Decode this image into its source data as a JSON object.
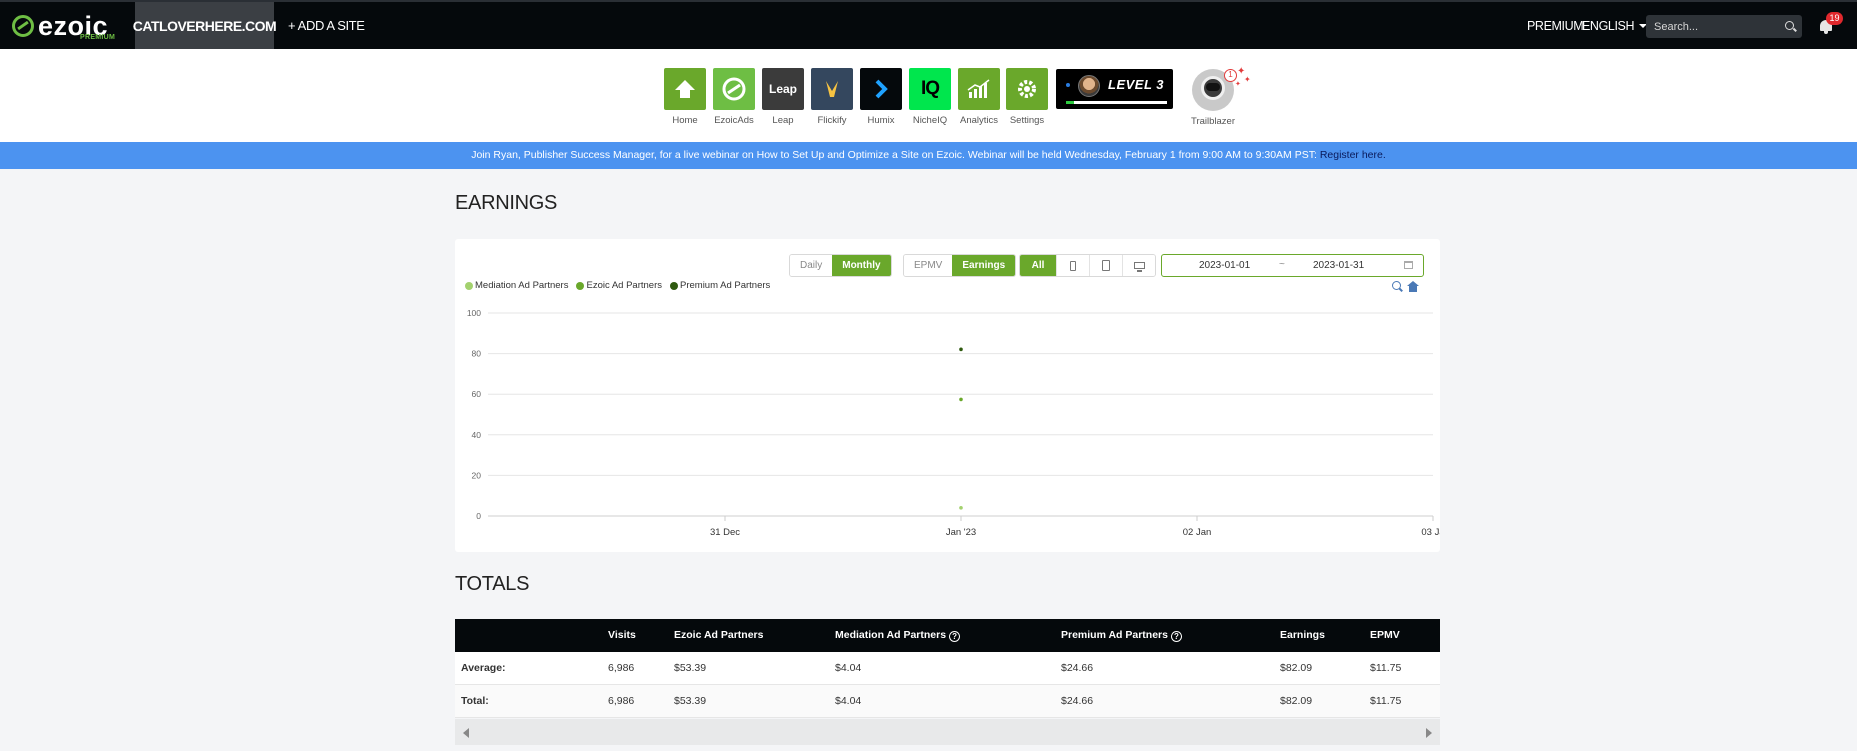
{
  "topnav": {
    "logo_text": "ezoic",
    "logo_sub": "PREMIUM",
    "site_name": "CATLOVERHERE.COM",
    "add_site": "+ ADD A SITE",
    "premium": "PREMIUM",
    "language": "ENGLISH",
    "search_placeholder": "Search...",
    "notifications_count": "19"
  },
  "apps": [
    {
      "label": "Home",
      "icon": "home-icon",
      "color": "#6aa82b"
    },
    {
      "label": "EzoicAds",
      "icon": "ezoicads-icon",
      "color": "#6ebe44"
    },
    {
      "label": "Leap",
      "icon": "leap-icon",
      "color": "#3b3b3b",
      "tile_text": "Leap"
    },
    {
      "label": "Flickify",
      "icon": "flickify-icon",
      "color": "#34475e"
    },
    {
      "label": "Humix",
      "icon": "humix-icon",
      "color": "#05090c"
    },
    {
      "label": "NicheIQ",
      "icon": "nicheiq-icon",
      "color": "#00e64d",
      "tile_text": "IQ"
    },
    {
      "label": "Analytics",
      "icon": "analytics-icon",
      "color": "#6aa82b"
    },
    {
      "label": "Settings",
      "icon": "settings-icon",
      "color": "#6aa82b"
    }
  ],
  "level": {
    "text": "LEVEL 3",
    "progress": 0.08
  },
  "trailblazer": {
    "label": "Trailblazer",
    "notif": "1"
  },
  "banner": {
    "text": "Join Ryan, Publisher Success Manager, for a live webinar on How to Set Up and Optimize a Site on Ezoic. Webinar will be held Wednesday, February 1 from 9:00 AM to 9:30AM PST: ",
    "link": "Register here."
  },
  "earnings": {
    "title": "EARNINGS",
    "period_buttons": [
      "Daily",
      "Monthly"
    ],
    "active_period": "Monthly",
    "metric_buttons": [
      "EPMV",
      "Earnings"
    ],
    "active_metric": "Earnings",
    "device_all": "All",
    "device_icons": [
      "phone-icon",
      "tablet-icon",
      "desktop-icon"
    ],
    "date_start": "2023-01-01",
    "date_sep": "~",
    "date_end": "2023-01-31"
  },
  "chart_data": {
    "type": "scatter",
    "title": "",
    "xlabel": "",
    "ylabel": "",
    "x_ticks": [
      "31 Dec",
      "Jan '23",
      "02 Jan",
      "03 Ja"
    ],
    "y_ticks": [
      0,
      20,
      40,
      60,
      80,
      100
    ],
    "ylim": [
      0,
      100
    ],
    "grid": true,
    "legend_position": "top-left",
    "series": [
      {
        "name": "Mediation Ad Partners",
        "color": "#a3d16e",
        "points": [
          {
            "x": "Jan '23",
            "y": 4.04
          }
        ]
      },
      {
        "name": "Ezoic Ad Partners",
        "color": "#6aa82b",
        "points": [
          {
            "x": "Jan '23",
            "y": 57.43
          }
        ]
      },
      {
        "name": "Premium Ad Partners",
        "color": "#2f5a0f",
        "points": [
          {
            "x": "Jan '23",
            "y": 82.09
          }
        ]
      }
    ]
  },
  "totals": {
    "title": "TOTALS",
    "columns": [
      "",
      "Visits",
      "Ezoic Ad Partners",
      "Mediation Ad Partners",
      "Premium Ad Partners",
      "Earnings",
      "EPMV"
    ],
    "help_mark": "?",
    "rows": [
      [
        "Average:",
        "6,986",
        "$53.39",
        "$4.04",
        "$24.66",
        "$82.09",
        "$11.75"
      ],
      [
        "Total:",
        "6,986",
        "$53.39",
        "$4.04",
        "$24.66",
        "$82.09",
        "$11.75"
      ]
    ]
  }
}
